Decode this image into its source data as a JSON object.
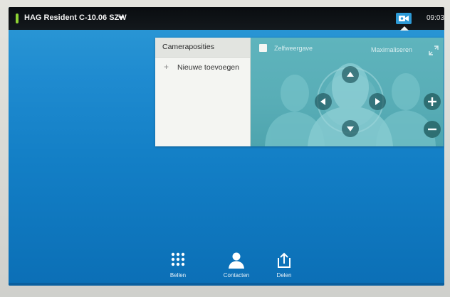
{
  "header": {
    "room_name": "HAG Resident C-10.06 SZW",
    "clock": "09:03",
    "status_color": "#8ed334"
  },
  "camera_panel": {
    "presets_title": "Cameraposities",
    "add_label": "Nieuwe toevoegen",
    "add_icon": "+",
    "selfview_label": "Zelfweergave",
    "selfview_checked": false,
    "maximize_label": "Maximaliseren",
    "controls": [
      "up-arrow-icon",
      "down-arrow-icon",
      "left-arrow-icon",
      "right-arrow-icon",
      "zoom-in-icon",
      "zoom-out-icon"
    ]
  },
  "bottom_bar": {
    "items": [
      {
        "label": "Bellen",
        "icon": "keypad-icon"
      },
      {
        "label": "Contacten",
        "icon": "contacts-icon"
      },
      {
        "label": "Delen",
        "icon": "share-icon"
      }
    ]
  },
  "colors": {
    "screen_top": "#2d9ad6",
    "screen_bottom": "#0b6fb6",
    "topbar": "#0a0d10",
    "camview": "#5fb4bd",
    "accent": "#2d9ad6"
  }
}
